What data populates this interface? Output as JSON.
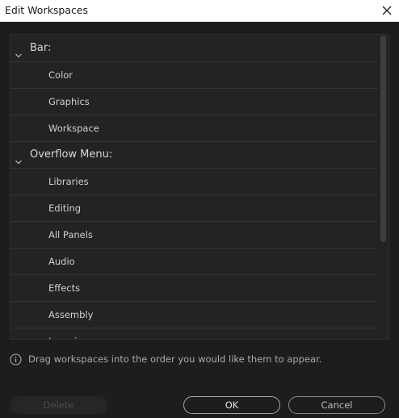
{
  "window": {
    "title": "Edit Workspaces",
    "close_icon": "close-icon"
  },
  "list": {
    "rows": [
      {
        "type": "group",
        "label": "Bar:"
      },
      {
        "type": "item",
        "label": "Color"
      },
      {
        "type": "item",
        "label": "Graphics"
      },
      {
        "type": "item",
        "label": "Workspace"
      },
      {
        "type": "group",
        "label": "Overflow Menu:"
      },
      {
        "type": "item",
        "label": "Libraries"
      },
      {
        "type": "item",
        "label": "Editing"
      },
      {
        "type": "item",
        "label": "All Panels"
      },
      {
        "type": "item",
        "label": "Audio"
      },
      {
        "type": "item",
        "label": "Effects"
      },
      {
        "type": "item",
        "label": "Assembly"
      },
      {
        "type": "item",
        "label": "Learning"
      }
    ]
  },
  "hint": {
    "icon": "info-icon",
    "text": "Drag workspaces into the order you would like them to appear."
  },
  "buttons": {
    "delete": "Delete",
    "ok": "OK",
    "cancel": "Cancel"
  }
}
